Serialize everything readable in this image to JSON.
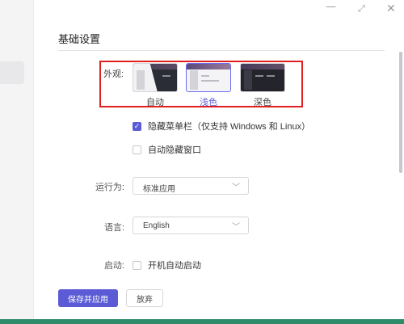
{
  "window": {
    "minimize_glyph": "—",
    "maximize_glyph": "⤢",
    "close_glyph": "✕"
  },
  "page": {
    "title": "基础设置"
  },
  "appearance": {
    "label": "外观:",
    "themes": [
      {
        "label": "自动",
        "selected": false
      },
      {
        "label": "浅色",
        "selected": true
      },
      {
        "label": "深色",
        "selected": false
      }
    ]
  },
  "options": {
    "hide_menu_bar": {
      "label": "隐藏菜单栏（仅支持 Windows 和 Linux）",
      "checked": true
    },
    "auto_hide_window": {
      "label": "自动隐藏窗口",
      "checked": false
    }
  },
  "run_as": {
    "label": "运行为:",
    "value": "标准应用"
  },
  "language": {
    "label": "语言:",
    "value": "English"
  },
  "startup": {
    "label": "启动:",
    "option_label": "开机自动启动",
    "checked": false
  },
  "actions": {
    "save_label": "保存并应用",
    "discard_label": "放弃"
  },
  "colors": {
    "accent": "#5b5bd6",
    "highlight": "#e02020",
    "bottom_bar": "#2e8c6a"
  },
  "icons": {
    "check": "check-icon",
    "chevron": "chevron-down-icon"
  }
}
